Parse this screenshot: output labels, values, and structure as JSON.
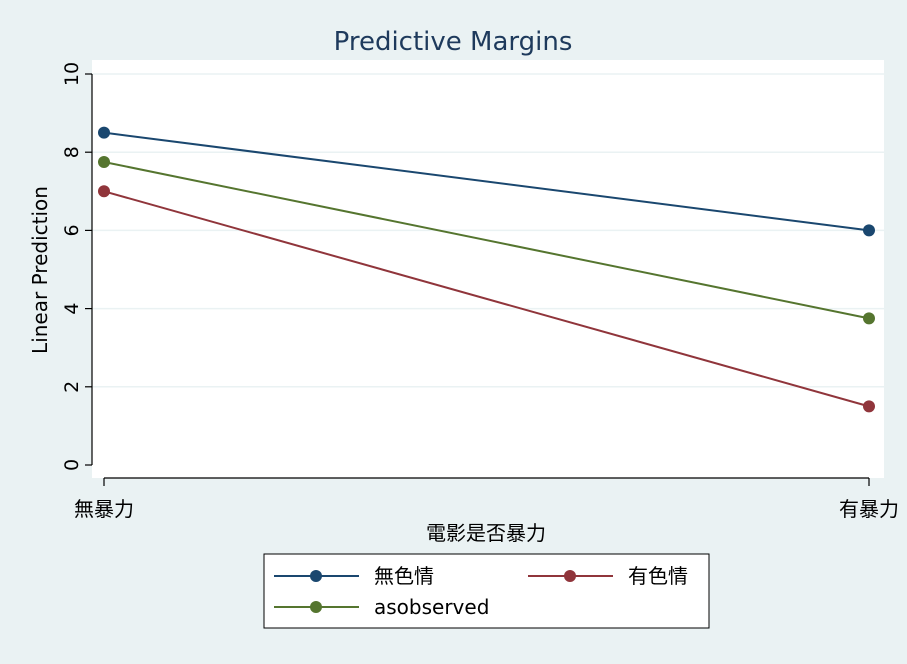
{
  "chart_data": {
    "type": "line",
    "title": "Predictive Margins",
    "xlabel": "電影是否暴力",
    "ylabel": "Linear Prediction",
    "categories": [
      "無暴力",
      "有暴力"
    ],
    "ylim": [
      0,
      10
    ],
    "yticks": [
      0,
      2,
      4,
      6,
      8,
      10
    ],
    "grid": true,
    "legend_position": "bottom",
    "series": [
      {
        "name": "無色情",
        "values": [
          8.5,
          6.0
        ],
        "color": "#1a476f"
      },
      {
        "name": "有色情",
        "values": [
          7.0,
          1.5
        ],
        "color": "#90353b"
      },
      {
        "name": "asobserved",
        "values": [
          7.75,
          3.75
        ],
        "color": "#55752f"
      }
    ]
  },
  "colors": {
    "background": "#eaf2f3",
    "plot_background": "#ffffff",
    "grid": "#eaf2f3",
    "axis": "#000000"
  }
}
